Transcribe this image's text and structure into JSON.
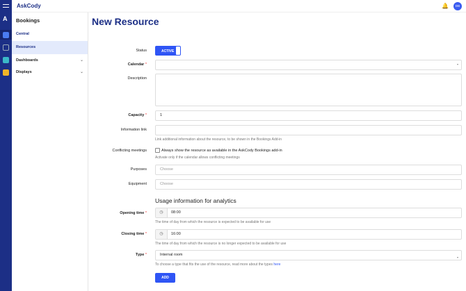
{
  "app": {
    "brand": "AskCody",
    "user_initials": "DB"
  },
  "sidebar": {
    "title": "Bookings",
    "items": [
      {
        "label": "Central"
      },
      {
        "label": "Resources"
      },
      {
        "label": "Dashboards"
      },
      {
        "label": "Displays"
      }
    ]
  },
  "page": {
    "title": "New Resource"
  },
  "form": {
    "status": {
      "label": "Status",
      "value": "ACTIVE"
    },
    "calendar": {
      "label": "Calendar",
      "value": ""
    },
    "description": {
      "label": "Description",
      "value": ""
    },
    "capacity": {
      "label": "Capacity",
      "value": "1"
    },
    "info_link": {
      "label": "Information link",
      "value": "",
      "help": "Link additional information about the resource, to be shown in the Bookings Add-in"
    },
    "conflicting": {
      "label": "Conflicting meetings",
      "checkbox_label": "Always show the resource as available in the AskCody Bookings add-in",
      "help": "Activate only if the calendar allows conflicting meetings"
    },
    "purposes": {
      "label": "Purposes",
      "placeholder": "Choose"
    },
    "equipment": {
      "label": "Equipment",
      "placeholder": "Choose"
    },
    "section_heading": "Usage information for analytics",
    "opening": {
      "label": "Opening time",
      "value": "08:00",
      "help": "The time of day from which the resource is expected to be available for use"
    },
    "closing": {
      "label": "Closing time",
      "value": "16:00",
      "help": "The time of day from which the resource is no longer expected to be available for use"
    },
    "type": {
      "label": "Type",
      "value": "Internal room",
      "help": "To choose a type that fits the use of the resource, read more about the types ",
      "link": "here"
    },
    "submit": "ADD",
    "required_mark": "*"
  }
}
